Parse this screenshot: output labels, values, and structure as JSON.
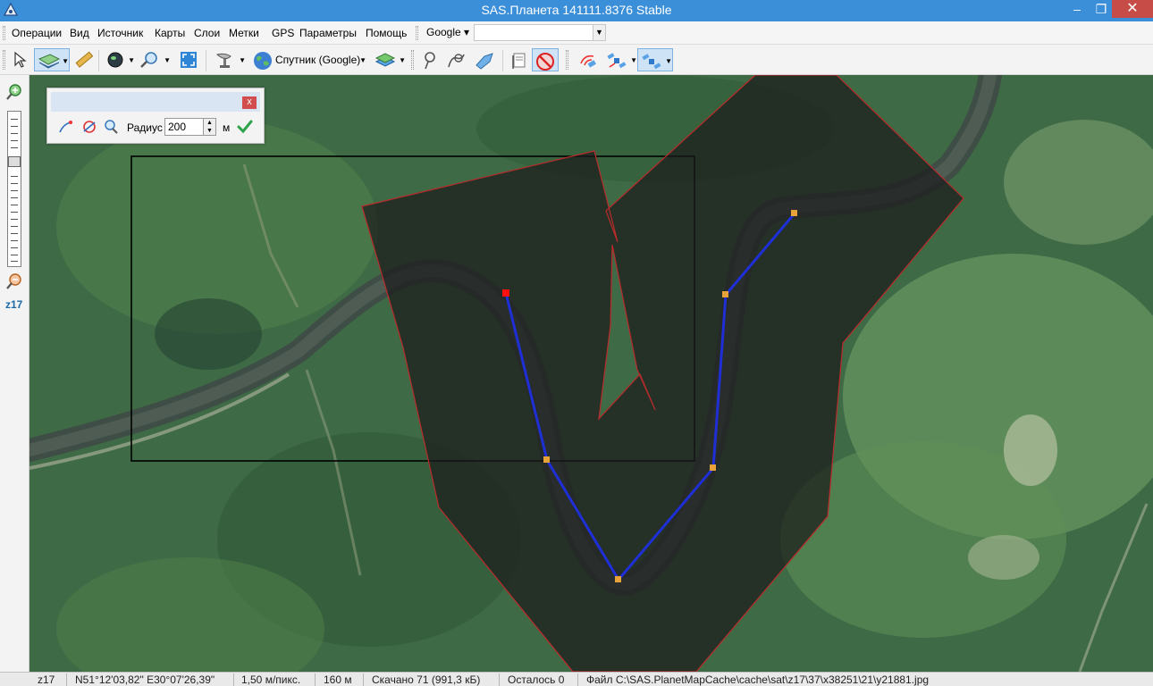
{
  "window": {
    "title": "SAS.Планета 141111.8376 Stable",
    "minimize": "‒",
    "maximize": "❐",
    "close": "✕"
  },
  "menu": {
    "items": [
      "Операции",
      "Вид",
      "Источник",
      "Карты",
      "Слои",
      "Метки",
      "GPS",
      "Параметры",
      "Помощь"
    ],
    "source_selector": "Google ▾",
    "source_search_value": ""
  },
  "toolbar": {
    "map_type_label": "Спутник (Google)"
  },
  "zoom": {
    "level_label": "z17"
  },
  "float_panel": {
    "radius_label": "Радиус",
    "radius_value": "200",
    "unit": "м",
    "close": "x"
  },
  "status": {
    "zoom": "z17",
    "coords": "N51°12'03,82\" E30°07'26,39\"",
    "scale": "1,50 м/пикс.",
    "distance": "160 м",
    "downloaded": "Скачано 71 (991,3 кБ)",
    "remaining": "Осталось 0",
    "file": "Файл C:\\SAS.PlanetMapCache\\cache\\sat\\z17\\37\\x38251\\21\\y21881.jpg"
  },
  "colors": {
    "titlebar": "#3b8fd9",
    "route": "#1f2fd6",
    "point": "#e8a23a",
    "start_point": "#ff1010",
    "polygon_edge": "#b92b2b"
  }
}
